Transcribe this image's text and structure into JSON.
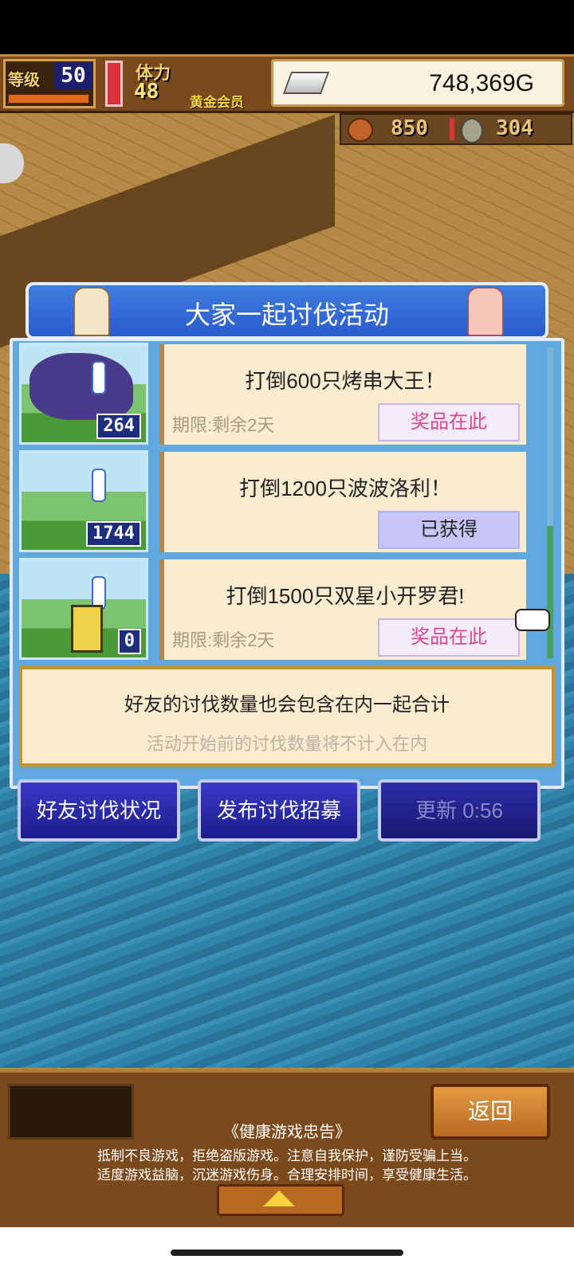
{
  "hud": {
    "level_label": "等级",
    "level_value": "50",
    "stamina_label": "体力",
    "stamina_value": "48",
    "membership": "黄金会员",
    "gold": "748,369G",
    "resource1": "850",
    "resource2": "304"
  },
  "panel": {
    "title": "大家一起讨伐活动",
    "missions": [
      {
        "text": "打倒600只烤串大王！",
        "count": "264",
        "deadline": "期限:剩余2天",
        "button": "奖品在此",
        "claimed": false
      },
      {
        "text": "打倒1200只波波洛利！",
        "count": "1744",
        "deadline": "",
        "button": "已获得",
        "claimed": true
      },
      {
        "text": "打倒1500只双星小开罗君!",
        "count": "0",
        "deadline": "期限:剩余2天",
        "button": "奖品在此",
        "claimed": false
      }
    ],
    "info_main": "好友的讨伐数量也会包含在内一起合计",
    "info_sub": "活动开始前的讨伐数量将不计入在内"
  },
  "actions": {
    "friend_status": "好友讨伐状况",
    "recruit": "发布讨伐招募",
    "refresh": "更新 0:56"
  },
  "bottom": {
    "back": "返回",
    "health_title": "《健康游戏忠告》",
    "health_line1": "抵制不良游戏，拒绝盗版游戏。注意自我保护，谨防受骗上当。",
    "health_line2": "适度游戏益脑，沉迷游戏伤身。合理安排时间，享受健康生活。"
  }
}
